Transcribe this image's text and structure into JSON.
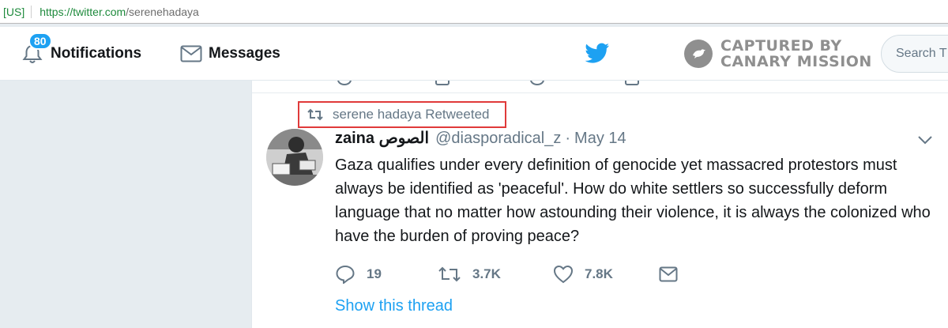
{
  "browser": {
    "badge": "[US]",
    "url_scheme": "https://",
    "url_host": "twitter.com",
    "url_path": "/serenehadaya"
  },
  "nav": {
    "notifications_label": "Notifications",
    "notifications_count": "80",
    "messages_label": "Messages",
    "search_placeholder": "Search T"
  },
  "watermark": {
    "line1": "CAPTURED BY",
    "line2": "CANARY MISSION"
  },
  "tweet": {
    "retweet_context": "serene hadaya Retweeted",
    "author_name": "zaina الصوص",
    "author_handle": "@diasporadical_z",
    "separator": "·",
    "time": "May 14",
    "text": "Gaza qualifies under every definition of genocide yet massacred protestors must always be identified as 'peaceful'. How do white settlers so successfully deform language that no matter how astounding their violence, it is always the colonized who have the burden of proving peace?",
    "replies": "19",
    "retweets": "3.7K",
    "likes": "7.8K",
    "show_thread": "Show this thread"
  },
  "colors": {
    "accent": "#1da1f2",
    "muted": "#657786",
    "highlight_box": "#e03a3a",
    "background": "#e6ecf0"
  },
  "icons": [
    "bell-icon",
    "mail-icon",
    "twitter-bird-icon",
    "canary-mission-icon",
    "retweet-icon",
    "reply-icon",
    "heart-icon",
    "dm-icon",
    "chevron-down-icon"
  ]
}
